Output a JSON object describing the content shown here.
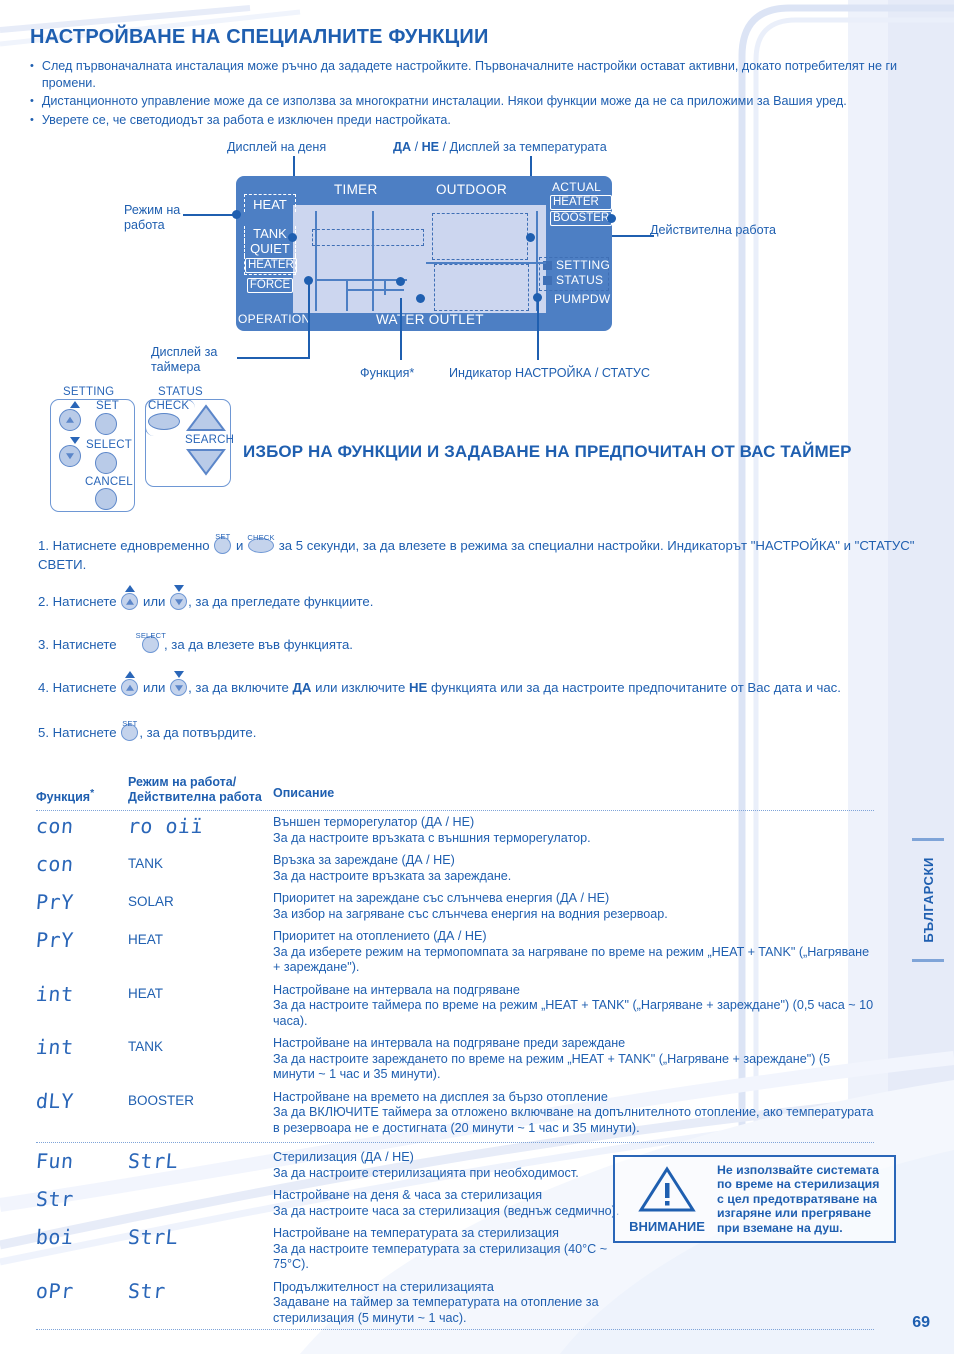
{
  "header": {
    "title": "НАСТРОЙВАНЕ НА СПЕЦИАЛНИТЕ ФУНКЦИИ",
    "bullets": [
      "След първоначалната инсталация може ръчно да зададете настройките. Първоначалните настройки остават активни, докато потребителят не ги промени.",
      "Дистанционното управление може да се използва за многократни инсталации. Някои функции може да не са приложими за Вашия уред.",
      "Уверете се, че светодиодът за работа е изключен преди настройката."
    ]
  },
  "diagram": {
    "callouts": {
      "day_display": "Дисплей на деня",
      "yes_no_temp": "ДА / НЕ / Дисплей за температурата",
      "yes_bold": "ДА",
      "no_bold": "НЕ",
      "operation_mode": "Режим на работа",
      "actual_operation": "Действителна работа",
      "timer_display": "Дисплей за таймера",
      "function": "Функция*",
      "setting_status_indicator": "Индикатор НАСТРОЙКА / СТАТУС"
    },
    "lcd": {
      "timer": "TIMER",
      "outdoor": "OUTDOOR",
      "actual": "ACTUAL",
      "heater": "HEATER",
      "booster": "BOOSTER",
      "setting": "SETTING",
      "status": "STATUS",
      "pumpdw": "PUMPDW",
      "heat": "HEAT",
      "tank": "TANK",
      "quiet": "QUIET",
      "heater_left": "HEATER",
      "force": "FORCE",
      "operation": "OPERATION",
      "water_outlet": "WATER OUTLET"
    }
  },
  "remote": {
    "setting_label": "SETTING",
    "status_label": "STATUS",
    "set": "SET",
    "select": "SELECT",
    "cancel": "CANCEL",
    "check": "CHECK",
    "search": "SEARCH"
  },
  "section_title": "ИЗБОР НА ФУНКЦИИ И ЗАДАВАНЕ НА ПРЕДПОЧИТАН ОТ ВАС ТАЙМЕР",
  "steps": {
    "s1_a": "1. Натиснете едновременно",
    "s1_and": "и",
    "s1_b": "за 5 секунди, за да влезете в режима за специални настройки. Индикаторът \"НАСТРОЙКА\" и \"СТАТУС\" СВЕТИ.",
    "s2_a": "2. Натиснете",
    "s2_or": "или",
    "s2_b": ", за да прегледате функциите.",
    "s3_a": "3. Натиснете",
    "s3_b": ", за да влезете във функцията.",
    "s4_a": "4. Натиснете",
    "s4_or": "или",
    "s4_b": ", за да включите",
    "s4_yes": "ДА",
    "s4_c": "или изключите",
    "s4_no": "НЕ",
    "s4_d": "функцията или за да настроите предпочитаните от Вас дата и час.",
    "s5_a": "5. Натиснете",
    "s5_b": ", за да потвърдите.",
    "cap_set": "SET",
    "cap_check": "CHECK",
    "cap_select": "SELECT"
  },
  "table": {
    "headers": {
      "function": "Функция",
      "function_star": "*",
      "mode": "Режим на работа/\nДействителна работа",
      "mode_l1": "Режим на работа/",
      "mode_l2": "Действителна работа",
      "description": "Описание"
    },
    "rows": [
      {
        "code": "con",
        "mode": "ro oiï",
        "mode_is_lcd": true,
        "desc_title": "Външен терморегулатор (ДА / НЕ)",
        "desc_body": "За да настроите връзката с външния терморегулатор."
      },
      {
        "code": "con",
        "mode": "TANK",
        "mode_is_lcd": false,
        "desc_title": "Връзка за зареждане (ДА / НЕ)",
        "desc_body": "За да настроите връзката за зареждане."
      },
      {
        "code": "PrY",
        "mode": "SOLAR",
        "mode_is_lcd": false,
        "desc_title": "Приоритет на зареждане със слънчева енергия (ДА / НЕ)",
        "desc_body": "За избор на загряване със слънчева енергия на водния резервоар."
      },
      {
        "code": "PrY",
        "mode": "HEAT",
        "mode_is_lcd": false,
        "desc_title": "Приоритет на отоплението (ДА / НЕ)",
        "desc_body": "За да изберете режим на термопомпата за нагряване по време на режим „HEAT + TANK\" („Нагряване + зареждане\")."
      },
      {
        "code": "int",
        "mode": "HEAT",
        "mode_is_lcd": false,
        "desc_title": "Настройване на интервала на подгряване",
        "desc_body": "За да настроите таймера по време на режим „HEAT + TANK\" („Нагряване + зареждане\") (0,5 часа ~ 10 часа)."
      },
      {
        "code": "int",
        "mode": "TANK",
        "mode_is_lcd": false,
        "desc_title": "Настройване на интервала на подгряване преди зареждане",
        "desc_body": "За да настроите зареждането по време на режим „HEAT + TANK\" („Нагряване + зареждане\") (5 минути ~ 1 час и 35 минути)."
      },
      {
        "code": "dLY",
        "mode": "BOOSTER",
        "mode_is_lcd": false,
        "desc_title": "Настройване на времето на дисплея за бързо отопление",
        "desc_body": "За да ВКЛЮЧИТЕ таймера за отложено включване на допълнителното отопление, ако температурата в резервоара не е достигната (20 минути ~ 1 час и 35 минути)."
      },
      {
        "code": "Fun",
        "mode": "StrL",
        "mode_is_lcd": true,
        "desc_title": "Стерилизация (ДА / НЕ)",
        "desc_body": "За да настроите стерилизацията при необходимост."
      },
      {
        "code": "Str",
        "mode": "",
        "mode_is_lcd": true,
        "desc_title": "Настройване на деня & часа за стерилизация",
        "desc_body": "За да настроите часа за стерилизация (веднъж седмично)."
      },
      {
        "code": "boi",
        "mode": "StrL",
        "mode_is_lcd": true,
        "desc_title": "Настройване на температурата за стерилизация",
        "desc_body": "За да настроите температурата за стерилизация (40°C ~ 75°C)."
      },
      {
        "code": "oPr",
        "mode": "Str",
        "mode_is_lcd": true,
        "desc_title": "Продължителност на стерилизацията",
        "desc_body": "Задаване на таймер за температурата на отопление за стерилизация (5 минути ~ 1 час)."
      }
    ]
  },
  "caution": {
    "word": "ВНИМАНИЕ",
    "text": "Не използвайте системата по време на стерилизация с цел предотвратяване на изгаряне или прегряване при вземане на душ."
  },
  "footer": {
    "language_tab": "БЪЛГАРСКИ",
    "page_number": "69"
  },
  "colors": {
    "brand_blue": "#1f5fb0",
    "lcd_frame": "#4d7fc4",
    "lcd_screen": "#ccd6ef",
    "light_blue": "#b9cbe8",
    "rule": "#7fa4d8"
  }
}
